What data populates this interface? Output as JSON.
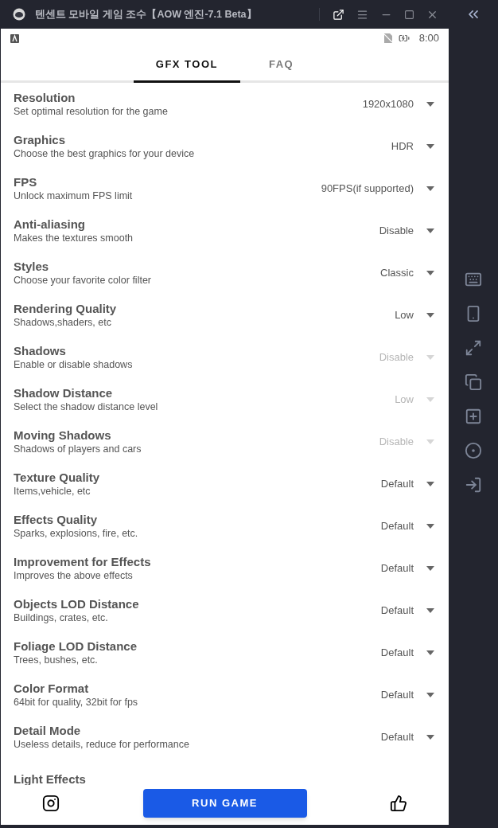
{
  "window": {
    "title": "텐센트 모바일 게임 조수【AOW 엔진-7.1 Beta】"
  },
  "status_bar": {
    "time": "8:00"
  },
  "tabs": [
    {
      "label": "GFX TOOL",
      "selected": true
    },
    {
      "label": "FAQ",
      "selected": false
    }
  ],
  "settings": [
    {
      "title": "Resolution",
      "subtitle": "Set optimal resolution for the game",
      "value": "1920x1080",
      "disabled": false
    },
    {
      "title": "Graphics",
      "subtitle": "Choose the best graphics for your device",
      "value": "HDR",
      "disabled": false
    },
    {
      "title": "FPS",
      "subtitle": "Unlock maximum FPS limit",
      "value": "90FPS(if supported)",
      "disabled": false
    },
    {
      "title": "Anti-aliasing",
      "subtitle": "Makes the textures smooth",
      "value": "Disable",
      "disabled": false
    },
    {
      "title": "Styles",
      "subtitle": "Choose your favorite color filter",
      "value": "Classic",
      "disabled": false
    },
    {
      "title": "Rendering Quality",
      "subtitle": "Shadows,shaders, etc",
      "value": "Low",
      "disabled": false
    },
    {
      "title": "Shadows",
      "subtitle": "Enable or disable shadows",
      "value": "Disable",
      "disabled": true
    },
    {
      "title": "Shadow Distance",
      "subtitle": "Select the shadow distance level",
      "value": "Low",
      "disabled": true
    },
    {
      "title": "Moving Shadows",
      "subtitle": "Shadows of players and cars",
      "value": "Disable",
      "disabled": true
    },
    {
      "title": "Texture Quality",
      "subtitle": "Items,vehicle, etc",
      "value": "Default",
      "disabled": false
    },
    {
      "title": "Effects Quality",
      "subtitle": "Sparks, explosions, fire, etc.",
      "value": "Default",
      "disabled": false
    },
    {
      "title": "Improvement for Effects",
      "subtitle": "Improves the above effects",
      "value": "Default",
      "disabled": false
    },
    {
      "title": "Objects LOD Distance",
      "subtitle": "Buildings, crates, etc.",
      "value": "Default",
      "disabled": false
    },
    {
      "title": "Foliage LOD Distance",
      "subtitle": "Trees, bushes, etc.",
      "value": "Default",
      "disabled": false
    },
    {
      "title": "Color Format",
      "subtitle": "64bit for quality, 32bit for fps",
      "value": "Default",
      "disabled": false
    },
    {
      "title": "Detail Mode",
      "subtitle": "Useless details, reduce for performance",
      "value": "Default",
      "disabled": false
    },
    {
      "title": "Light Effects"
    }
  ],
  "run_button": {
    "label": "RUN GAME"
  }
}
